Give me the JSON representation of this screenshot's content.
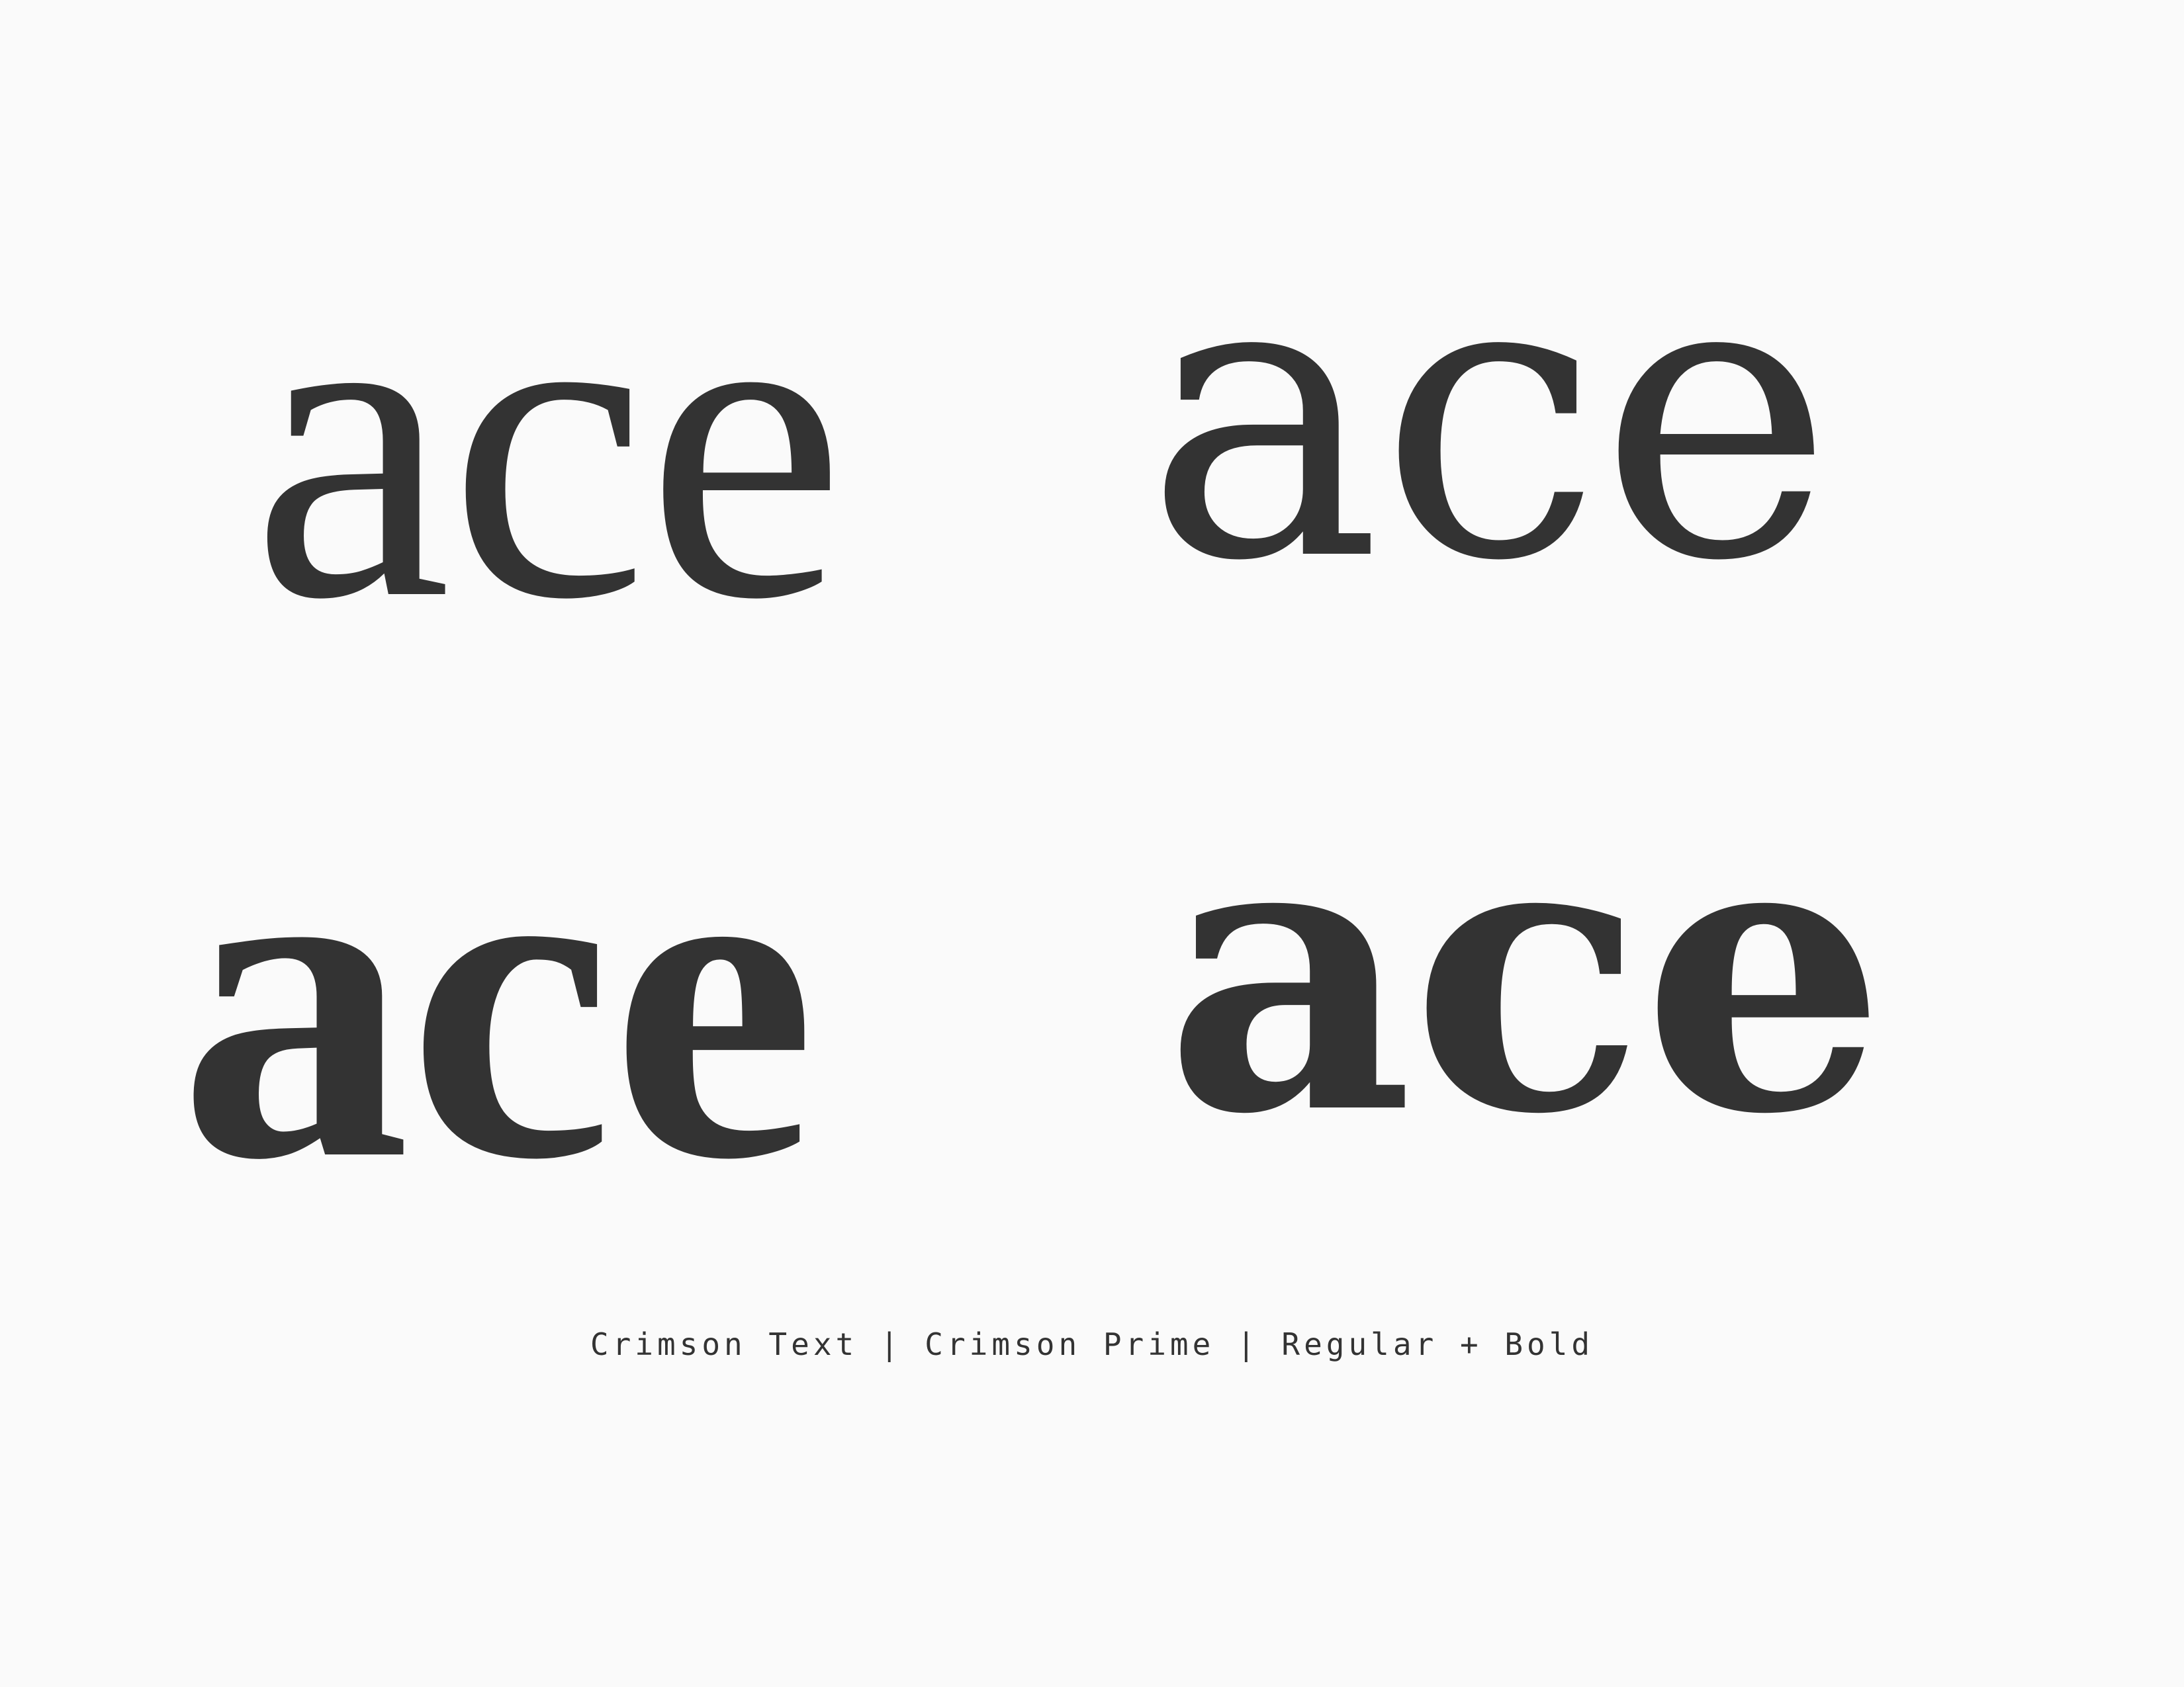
{
  "specimens": {
    "crimson_text_regular": "ace",
    "crimson_prime_regular": "ace",
    "crimson_text_bold": "ace",
    "crimson_prime_bold": "ace"
  },
  "caption": "Crimson Text | Crimson Prime | Regular + Bold",
  "colors": {
    "background": "#fafafa",
    "ink": "#333333"
  }
}
